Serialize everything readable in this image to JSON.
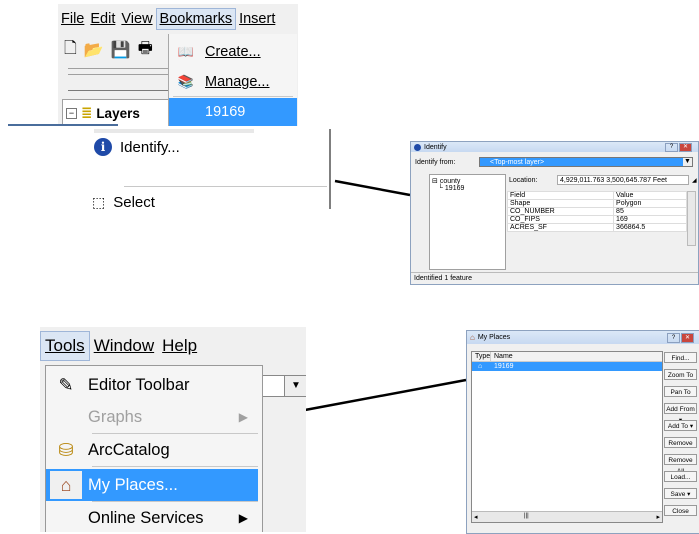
{
  "panel1": {
    "menubar": {
      "file": "File",
      "edit": "Edit",
      "view": "View",
      "bookmarks": "Bookmarks",
      "insert": "Insert"
    },
    "toolbar_icons": [
      "new-document-icon",
      "open-folder-icon",
      "save-icon",
      "print-icon"
    ],
    "layers_label": "Layers",
    "dropdown": {
      "create": "Create...",
      "manage": "Manage...",
      "bookmark": "19169"
    }
  },
  "panel2": {
    "identify": "Identify...",
    "select": "Select"
  },
  "identify_window": {
    "title": "Identify",
    "identify_from_label": "Identify from:",
    "identify_from_value": "<Top-most layer>",
    "tree": {
      "root": "county",
      "child": "19169"
    },
    "location_label": "Location:",
    "location_value": "4,929,011.763  3,500,645.787 Feet",
    "columns": [
      "Field",
      "Value"
    ],
    "rows": [
      {
        "field": "Shape",
        "value": "Polygon"
      },
      {
        "field": "CO_NUMBER",
        "value": "85"
      },
      {
        "field": "CO_FIPS",
        "value": "169"
      },
      {
        "field": "ACRES_SF",
        "value": "366864.5"
      }
    ],
    "status": "Identified 1 feature"
  },
  "panel4": {
    "menubar": {
      "tools": "Tools",
      "window": "Window",
      "help": "Help"
    },
    "items": {
      "editor_toolbar": "Editor Toolbar",
      "graphs": "Graphs",
      "arccatalog": "ArcCatalog",
      "my_places": "My Places...",
      "online_services": "Online Services"
    }
  },
  "myplaces_window": {
    "title": "My Places",
    "columns": [
      "Type",
      "Name"
    ],
    "row_name": "19169",
    "buttons": {
      "find": "Find...",
      "zoom_to": "Zoom To",
      "pan_to": "Pan To",
      "add_from": "Add From",
      "add_to": "Add To",
      "remove": "Remove",
      "remove_all": "Remove All",
      "load": "Load...",
      "save": "Save",
      "close": "Close"
    }
  },
  "colors": {
    "selection": "#3399ff",
    "menu_bg": "#f0f0f0",
    "window_border": "#8da2bf"
  }
}
